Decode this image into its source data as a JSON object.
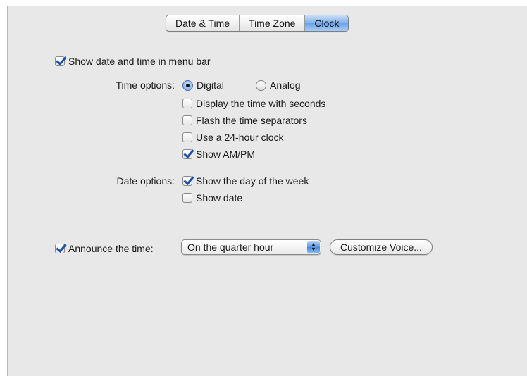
{
  "tabs": [
    {
      "label": "Date & Time",
      "active": false
    },
    {
      "label": "Time Zone",
      "active": false
    },
    {
      "label": "Clock",
      "active": true
    }
  ],
  "show_menu_bar": {
    "label": "Show date and time in menu bar",
    "checked": true
  },
  "time_options": {
    "label": "Time options:",
    "digital": {
      "label": "Digital",
      "selected": true
    },
    "analog": {
      "label": "Analog",
      "selected": false
    },
    "display_seconds": {
      "label": "Display the time with seconds",
      "checked": false
    },
    "flash_separators": {
      "label": "Flash the time separators",
      "checked": false
    },
    "use_24_hour": {
      "label": "Use a 24-hour clock",
      "checked": false
    },
    "show_ampm": {
      "label": "Show AM/PM",
      "checked": true
    }
  },
  "date_options": {
    "label": "Date options:",
    "show_day": {
      "label": "Show the day of the week",
      "checked": true
    },
    "show_date": {
      "label": "Show date",
      "checked": false
    }
  },
  "announce": {
    "label": "Announce the time:",
    "checked": true,
    "interval_selected": "On the quarter hour",
    "customize_label": "Customize Voice..."
  },
  "colors": {
    "window_bg": "#e8e8e8",
    "accent": "#6aa2e6",
    "check": "#1e4fa6"
  }
}
